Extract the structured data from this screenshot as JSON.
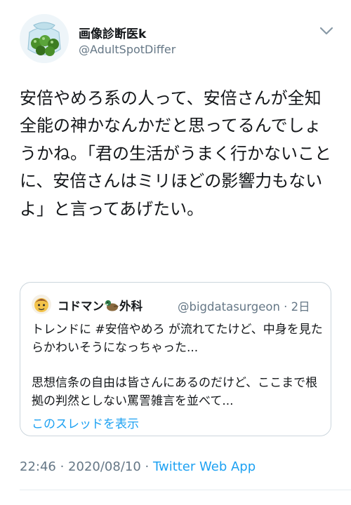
{
  "header": {
    "display_name": "画像診断医k",
    "handle": "@AdultSpotDiffer",
    "avatar_icon": "jar-of-green-balls-icon",
    "menu_icon": "chevron-down-icon"
  },
  "tweet": {
    "text": "安倍やめろ系の人って、安倍さんが全知全能の神かなんかだと思ってるんでしょうかね。「君の生活がうまく行かないことに、安倍さんはミリほどの影響力もないよ」と言ってあげたい。"
  },
  "quoted_tweet": {
    "display_name_before": "コドマン",
    "display_name_emoji": "duck-icon",
    "display_name_after": "外科",
    "handle_and_time": "@bigdatasurgeon · 2日",
    "avatar_icon": "cartoon-avatar-icon",
    "paragraph1": "トレンドに #安倍やめろ が流れてたけど、中身を見たらかわいそうになっちゃった...",
    "paragraph2": "思想信条の自由は皆さんにあるのだけど、ここまで根拠の判然としない罵詈雑言を並べて...",
    "show_thread": "このスレッドを表示"
  },
  "meta": {
    "time_date": "22:46 · 2020/08/10 · ",
    "source_app": "Twitter Web App"
  },
  "colors": {
    "link": "#1da1f2",
    "secondary_text": "#657786",
    "primary_text": "#14171a",
    "border": "#ccd6dd"
  }
}
